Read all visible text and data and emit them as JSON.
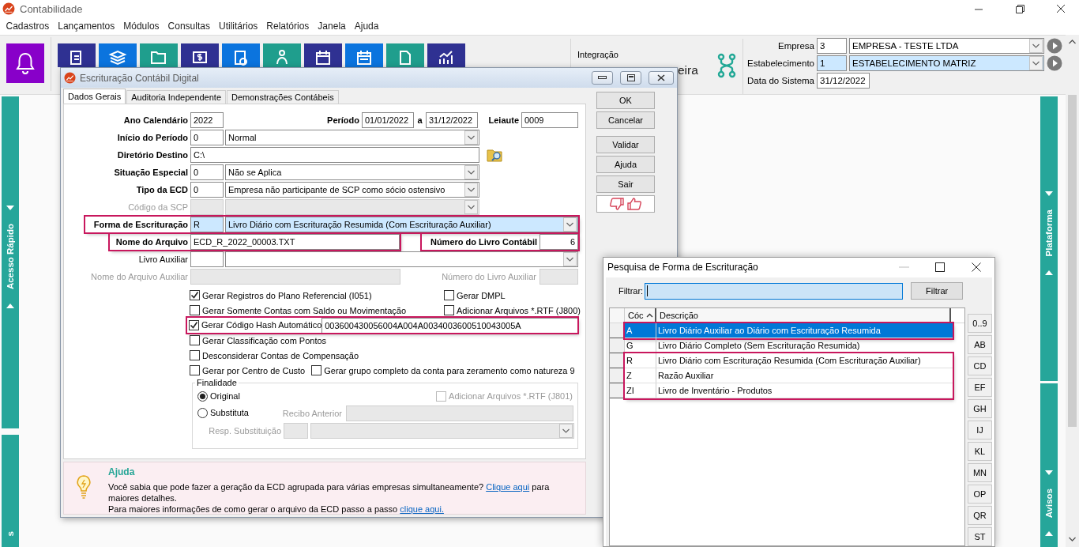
{
  "app": {
    "title": "Contabilidade"
  },
  "menu": [
    "Cadastros",
    "Lançamentos",
    "Módulos",
    "Consultas",
    "Utilitários",
    "Relatórios",
    "Janela",
    "Ajuda"
  ],
  "toolbar": {
    "integration_label": "Integração",
    "integration_cut": "eira"
  },
  "company": {
    "empresa": {
      "label": "Empresa",
      "code": "3",
      "name": "EMPRESA - TESTE LTDA",
      "focused": false
    },
    "estabelecimento": {
      "label": "Estabelecimento",
      "code": "1",
      "name": "ESTABELECIMENTO MATRIZ",
      "focused": true
    },
    "data": {
      "label": "Data do Sistema",
      "value": "31/12/2022"
    }
  },
  "side_panels": {
    "left": [
      {
        "label": "Acesso Rápido"
      },
      {
        "label": "s"
      }
    ],
    "right": [
      {
        "label": "Plataforma"
      },
      {
        "label": "Avisos"
      }
    ]
  },
  "ecd_dialog": {
    "title": "Escrituração Contábil Digital",
    "tabs": [
      {
        "label": "Dados Gerais",
        "selected": true
      },
      {
        "label": "Auditoria Independente",
        "selected": false
      },
      {
        "label": "Demonstrações Contábeis",
        "selected": false
      }
    ],
    "form": {
      "ano_calendario": {
        "label": "Ano Calendário",
        "value": "2022"
      },
      "periodo": {
        "label": "Período",
        "from": "01/01/2022",
        "sep": "a",
        "to": "31/12/2022"
      },
      "leiaute": {
        "label": "Leiaute",
        "value": "0009"
      },
      "inicio": {
        "label": "Início do Período",
        "code": "0",
        "value": "Normal"
      },
      "diretorio": {
        "label": "Diretório Destino",
        "value": "C:\\"
      },
      "situacao": {
        "label": "Situação Especial",
        "code": "0",
        "value": "Não se Aplica"
      },
      "tipo": {
        "label": "Tipo da ECD",
        "code": "0",
        "value": "Empresa não participante de SCP como sócio ostensivo"
      },
      "codigo_scp": {
        "label": "Código da SCP",
        "disabled": true
      },
      "forma": {
        "label": "Forma de Escrituração",
        "code": "R",
        "value": "Livro Diário com Escrituração Resumida (Com Escrituração Auxiliar)",
        "focused": true,
        "highlighted": true
      },
      "nome_arquivo": {
        "label": "Nome do Arquivo",
        "value": "ECD_R_2022_00003.TXT",
        "highlighted": true
      },
      "numero_livro": {
        "label": "Número do Livro Contábil",
        "value": "6",
        "highlighted": true
      },
      "livro_auxiliar": {
        "label": "Livro Auxiliar"
      },
      "nome_arquivo_aux": {
        "label": "Nome do Arquivo Auxiliar",
        "disabled": true
      },
      "numero_livro_aux": {
        "label": "Número do Livro Auxiliar",
        "disabled": true
      },
      "checks": [
        {
          "kind": "checkbox",
          "label": "Gerar Registros do Plano Referencial (I051)",
          "checked": true
        },
        {
          "kind": "checkbox",
          "label": "Gerar Somente Contas com Saldo ou Movimentação",
          "checked": false
        },
        {
          "kind": "hash",
          "label": "Gerar Código Hash Automático",
          "checked": true,
          "value": "003600430056004A004A0034003600510043005A",
          "highlighted": true
        },
        {
          "kind": "checkbox",
          "label": "Gerar Classificação com Pontos",
          "checked": false
        },
        {
          "kind": "checkbox",
          "label": "Desconsiderar Contas de Compensação",
          "checked": false
        },
        {
          "kind": "checkbox",
          "label": "Gerar por Centro de Custo",
          "checked": false,
          "next": {
            "label": "Gerar grupo completo da conta para zeramento como natureza 9",
            "checked": false
          }
        }
      ],
      "checks_right": [
        {
          "label": "Gerar DMPL",
          "checked": false
        },
        {
          "label": "Adicionar Arquivos *.RTF (J800)",
          "checked": false
        }
      ],
      "finalidade": {
        "title": "Finalidade",
        "options": [
          {
            "label": "Original",
            "selected": true
          },
          {
            "label": "Substituta",
            "selected": false
          }
        ],
        "rtf": {
          "label": "Adicionar Arquivos *.RTF (J801)",
          "checked": false,
          "disabled": true
        },
        "recibo": {
          "label": "Recibo Anterior",
          "disabled": true
        },
        "resp": {
          "label": "Resp. Substituição",
          "disabled": true
        }
      }
    },
    "buttons": [
      "OK",
      "Cancelar",
      "Validar",
      "Ajuda",
      "Sair"
    ],
    "help": {
      "title": "Ajuda",
      "paragraphs": [
        {
          "before": "Você sabia que pode fazer a geração da ECD agrupada para várias empresas simultaneamente?",
          "link": "Clique aqui",
          "after": "para maiores detalhes."
        },
        {
          "before": "Para maiores informações de como gerar o arquivo da ECD passo a passo",
          "link": "clique aqui."
        }
      ]
    }
  },
  "search_dialog": {
    "title": "Pesquisa de Forma de Escrituração",
    "filter": {
      "label": "Filtrar:",
      "focused": true,
      "button": "Filtrar"
    },
    "columns": [
      {
        "label": "Cóc",
        "sorted_ascending": true
      },
      {
        "label": "Descrição",
        "sorted_ascending": false
      }
    ],
    "rows": [
      {
        "code": "A",
        "description": "Livro Diário Auxiliar ao Diário com Escrituração Resumida",
        "selected": true,
        "highlighted": true
      },
      {
        "code": "G",
        "description": "Livro Diário Completo (Sem Escrituração Resumida)",
        "selected": false,
        "highlighted": false
      },
      {
        "code": "R",
        "description": "Livro Diário com Escrituração Resumida (Com Escrituração Auxiliar)",
        "selected": false,
        "highlighted": true
      },
      {
        "code": "Z",
        "description": "Razão Auxiliar",
        "selected": false,
        "highlighted": true
      },
      {
        "code": "ZI",
        "description": "Livro de Inventário - Produtos",
        "selected": false,
        "highlighted": true
      }
    ],
    "letters": [
      "0..9",
      "AB",
      "CD",
      "EF",
      "GH",
      "IJ",
      "KL",
      "MN",
      "OP",
      "QR",
      "ST"
    ]
  }
}
